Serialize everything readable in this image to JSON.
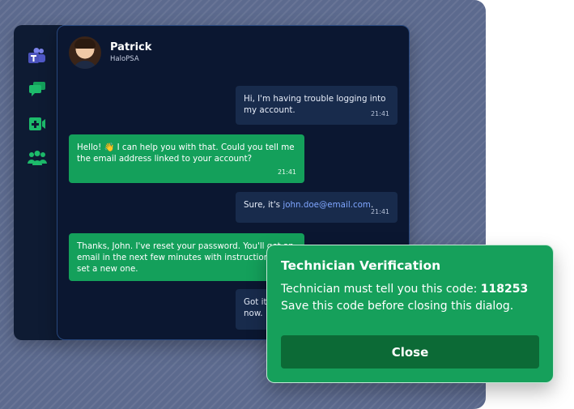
{
  "contact": {
    "name": "Patrick",
    "org": "HaloPSA"
  },
  "sidebar": {
    "icons": [
      "teams-icon",
      "chat-icon",
      "video-icon",
      "people-icon"
    ]
  },
  "messages": [
    {
      "side": "out",
      "text": "Hi, I'm having trouble logging into my account.",
      "time": "21:41"
    },
    {
      "side": "in",
      "text": "Hello! 👋 I can help you with that. Could you tell me the email address linked to your account?",
      "time": "21:41"
    },
    {
      "side": "out",
      "prefix": "Sure, it's ",
      "email": "john.doe@email.com",
      "suffix": ".",
      "time": "21:41"
    },
    {
      "side": "in",
      "text": "Thanks, John. I've reset your password. You'll get an email in the next few minutes with instructions to set a new one."
    },
    {
      "side": "out",
      "text": "Got it now."
    }
  ],
  "dialog": {
    "title": "Technician Verification",
    "line1_prefix": "Technician must tell you this code: ",
    "code": "118253",
    "line2": "Save this code before closing this dialog.",
    "close_label": "Close"
  },
  "colors": {
    "accent_green": "#14a05b",
    "dark_green": "#0c6a36",
    "panel_bg": "#0b1731",
    "bubble_out": "#182b4c",
    "link": "#7fa6ff"
  }
}
